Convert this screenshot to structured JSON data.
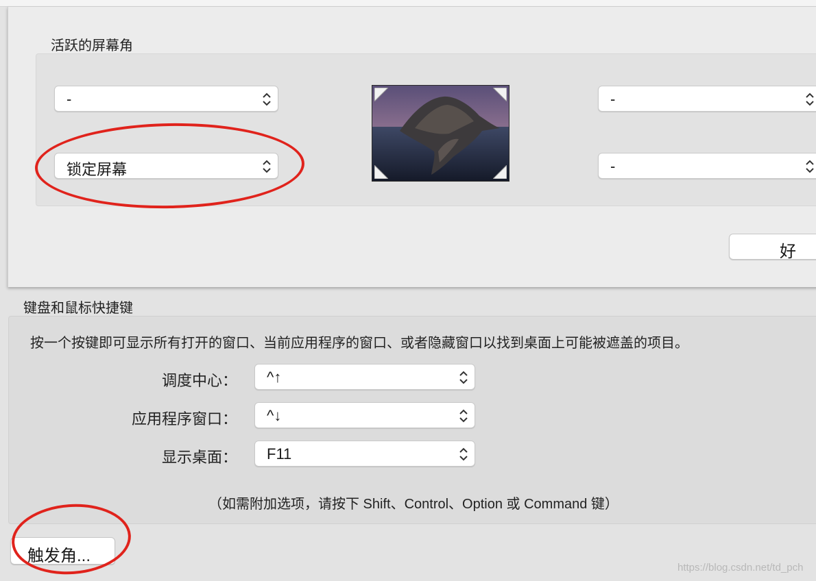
{
  "hot_corners": {
    "title": "活跃的屏幕角",
    "top_left": "-",
    "bottom_left": "锁定屏幕",
    "top_right": "-",
    "bottom_right": "-",
    "ok_label": "好"
  },
  "keyboard": {
    "title": "键盘和鼠标快捷键",
    "description": "按一个按键即可显示所有打开的窗口、当前应用程序的窗口、或者隐藏窗口以找到桌面上可能被遮盖的项目。",
    "rows": [
      {
        "label": "调度中心：",
        "value": "^↑"
      },
      {
        "label": "应用程序窗口：",
        "value": "^↓"
      },
      {
        "label": "显示桌面：",
        "value": "F11"
      }
    ],
    "hint": "（如需附加选项，请按下 Shift、Control、Option 或 Command 键）"
  },
  "hot_corners_button": "触发角...",
  "watermark": "https://blog.csdn.net/td_pch",
  "colors": {
    "annotation": "#e0231c",
    "accent_bg": "#ececec"
  }
}
